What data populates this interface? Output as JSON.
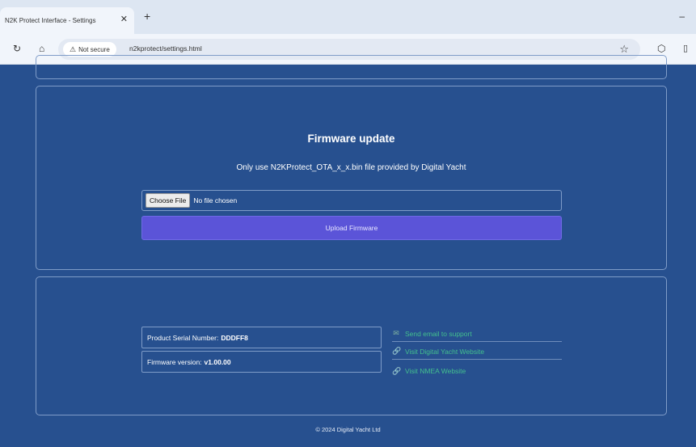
{
  "browser": {
    "tab_title": "N2K Protect Interface - Settings",
    "tab_close": "✕",
    "new_tab": "+",
    "minimize": "–",
    "security_label": "Not secure",
    "url": "n2kprotect/settings.html"
  },
  "firmware": {
    "title": "Firmware update",
    "note": "Only use N2KProtect_OTA_x_x.bin file provided by Digital Yacht",
    "choose_file_label": "Choose File",
    "file_state": "No file chosen",
    "upload_label": "Upload Firmware"
  },
  "info": {
    "serial_label": "Product Serial Number:",
    "serial_value": "DDDFF8",
    "fw_label": "Firmware version:",
    "fw_value": "v1.00.00",
    "links": [
      {
        "label": "Send email to support",
        "icon": "envelope-icon"
      },
      {
        "label": "Visit Digital Yacht Website",
        "icon": "link-icon"
      },
      {
        "label": "Visit NMEA Website",
        "icon": "link-icon"
      }
    ]
  },
  "footer": "© 2024 Digital Yacht Ltd",
  "colors": {
    "page_bg": "#27508f",
    "upload_button": "#5b54d8",
    "link": "#43c08e"
  }
}
